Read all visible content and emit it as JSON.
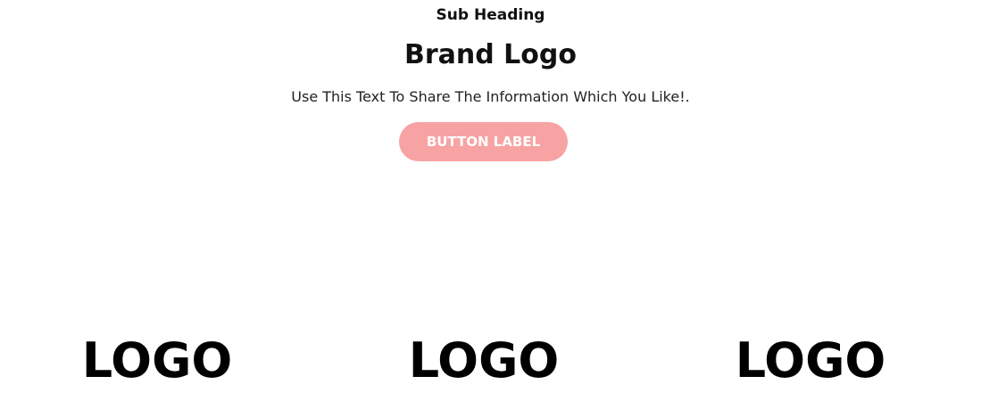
{
  "hero": {
    "sub_heading": "Sub Heading",
    "title": "Brand Logo",
    "description": "Use This Text To Share The Information Which You Like!.",
    "button_label": "BUTTON LABEL"
  },
  "logos": [
    {
      "label": "LOGO"
    },
    {
      "label": "LOGO"
    },
    {
      "label": "LOGO"
    }
  ],
  "colors": {
    "button_background": "#f7a3a3",
    "button_text": "#ffffff",
    "text_primary": "#111111"
  }
}
